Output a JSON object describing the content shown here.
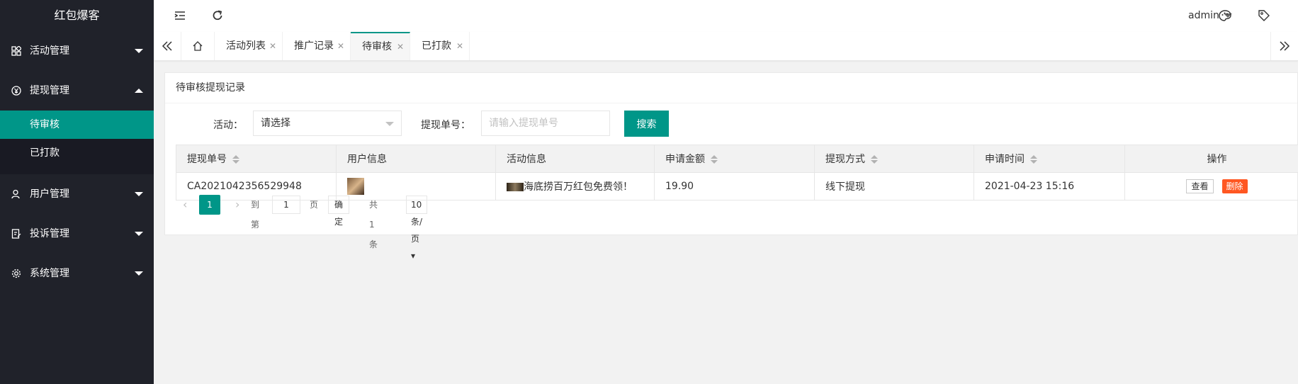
{
  "app": {
    "logo": "红包爆客"
  },
  "sidebar": {
    "items": [
      {
        "label": "活动管理"
      },
      {
        "label": "提现管理"
      },
      {
        "label": "用户管理"
      },
      {
        "label": "投诉管理"
      },
      {
        "label": "系统管理"
      }
    ],
    "subitems": [
      {
        "label": "待审核"
      },
      {
        "label": "已打款"
      }
    ]
  },
  "header": {
    "user": "admin"
  },
  "tabs": [
    {
      "label": "活动列表"
    },
    {
      "label": "推广记录"
    },
    {
      "label": "待审核"
    },
    {
      "label": "已打款"
    }
  ],
  "card": {
    "title": "待审核提现记录"
  },
  "filters": {
    "activity_label": "活动：",
    "activity_value": "请选择",
    "order_label": "提现单号：",
    "order_placeholder": "请输入提现单号",
    "search_label": "搜索"
  },
  "table": {
    "headers": [
      "提现单号",
      "用户信息",
      "活动信息",
      "申请金额",
      "提现方式",
      "申请时间",
      "操作"
    ],
    "rows": [
      {
        "order_no": "CA2021042356529948",
        "activity": "海底捞百万红包免费领！",
        "amount": "19.90",
        "method": "线下提现",
        "time": "2021-04-23 15:16",
        "view": "查看",
        "delete": "删除"
      }
    ]
  },
  "pagination": {
    "current": "1",
    "goto_label": "到第",
    "page_input": "1",
    "page_suffix": "页",
    "confirm": "确定",
    "total": "共 1 条",
    "per_page": "10 条/页"
  },
  "colors": {
    "accent": "#009688",
    "danger": "#ff5722",
    "sidebar": "#20222a"
  }
}
